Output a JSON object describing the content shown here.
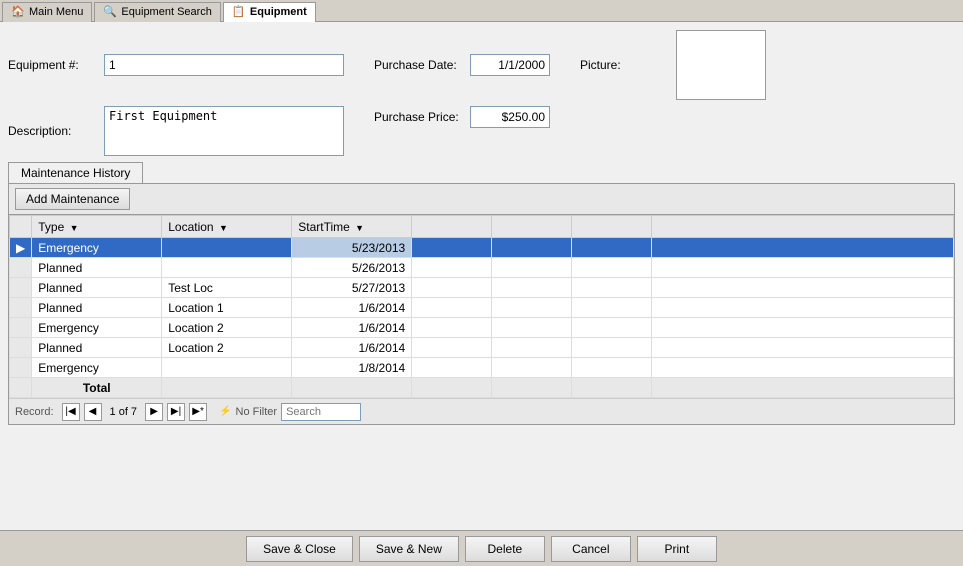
{
  "tabs": [
    {
      "id": "main-menu",
      "label": "Main Menu",
      "icon": "🏠",
      "active": false
    },
    {
      "id": "equipment-search",
      "label": "Equipment Search",
      "icon": "🔍",
      "active": false
    },
    {
      "id": "equipment",
      "label": "Equipment",
      "icon": "📋",
      "active": true
    }
  ],
  "form": {
    "equipment_number_label": "Equipment #:",
    "equipment_number_value": "1",
    "description_label": "Description:",
    "description_value": "First Equipment",
    "purchase_date_label": "Purchase Date:",
    "purchase_date_value": "1/1/2000",
    "purchase_price_label": "Purchase Price:",
    "purchase_price_value": "$250.00",
    "picture_label": "Picture:"
  },
  "maintenance_tab": {
    "label": "Maintenance History",
    "add_button": "Add Maintenance"
  },
  "grid": {
    "columns": [
      {
        "id": "type",
        "label": "Type",
        "sortable": true
      },
      {
        "id": "location",
        "label": "Location",
        "sortable": true
      },
      {
        "id": "starttime",
        "label": "StartTime",
        "sortable": true
      }
    ],
    "rows": [
      {
        "selected": true,
        "type": "Emergency",
        "location": "",
        "starttime": "5/23/2013"
      },
      {
        "selected": false,
        "type": "Planned",
        "location": "",
        "starttime": "5/26/2013"
      },
      {
        "selected": false,
        "type": "Planned",
        "location": "Test Loc",
        "starttime": "5/27/2013"
      },
      {
        "selected": false,
        "type": "Planned",
        "location": "Location 1",
        "starttime": "1/6/2014"
      },
      {
        "selected": false,
        "type": "Emergency",
        "location": "Location 2",
        "starttime": "1/6/2014"
      },
      {
        "selected": false,
        "type": "Planned",
        "location": "Location 2",
        "starttime": "1/6/2014"
      },
      {
        "selected": false,
        "type": "Emergency",
        "location": "",
        "starttime": "1/8/2014"
      }
    ],
    "total_label": "Total"
  },
  "nav": {
    "record_label": "Record:",
    "current_record": "1 of 7",
    "no_filter_label": "No Filter",
    "search_placeholder": "Search"
  },
  "actions": {
    "save_close": "Save & Close",
    "save_new": "Save & New",
    "delete": "Delete",
    "cancel": "Cancel",
    "print": "Print"
  }
}
